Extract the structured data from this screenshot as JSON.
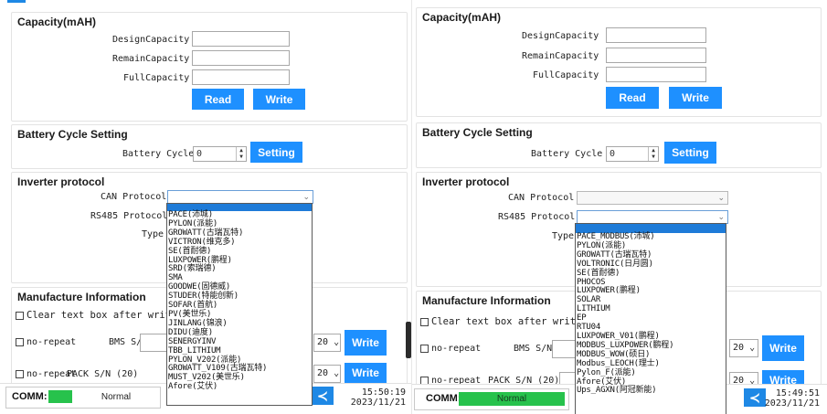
{
  "left": {
    "capacity": {
      "title": "Capacity(mAH)",
      "design_label": "DesignCapacity",
      "remain_label": "RemainCapacity",
      "full_label": "FullCapacity",
      "read_label": "Read",
      "write_label": "Write"
    },
    "cycle": {
      "title": "Battery Cycle Setting",
      "label": "Battery Cycle",
      "value": "0",
      "setting_label": "Setting"
    },
    "inverter": {
      "title": "Inverter protocol",
      "can_label": "CAN Protocol",
      "rs485_label": "RS485 Protocol",
      "type_label": "Type",
      "options": [
        "PACE(沛城)",
        "PYLON(派能)",
        "GROWATT(古瑞瓦特)",
        "VICTRON(维克多)",
        "SE(首耐德)",
        "LUXPOWER(鹏程)",
        "SRD(索瑞德)",
        "SMA",
        "GOODWE(固德威)",
        "STUDER(特能创新)",
        "SOFAR(首航)",
        "PV(美世乐)",
        "JINLANG(锦浪)",
        "DIDU(迪度)",
        "SENERGYINV",
        "TBB_LITHIUM",
        "PYLON_V202(派能)",
        "GROWATT_V109(古瑞瓦特)",
        "MUST_V202(美世乐)",
        "Afore(艾伏)"
      ]
    },
    "manufacture": {
      "title": "Manufacture Information",
      "clear_label": "Clear text box after writing",
      "norepeat_label": "no-repeat",
      "bms_label": "BMS S/N",
      "pack_label": "PACK S/N (20)",
      "len_value": "20",
      "write_label": "Write"
    },
    "status": {
      "comm_label": "COMM:",
      "comm_state": "Normal",
      "time": "15:50:19",
      "date": "2023/11/21"
    }
  },
  "right": {
    "capacity": {
      "title": "Capacity(mAH)",
      "design_label": "DesignCapacity",
      "remain_label": "RemainCapacity",
      "full_label": "FullCapacity",
      "read_label": "Read",
      "write_label": "Write"
    },
    "cycle": {
      "title": "Battery Cycle Setting",
      "label": "Battery Cycle",
      "value": "0",
      "setting_label": "Setting"
    },
    "inverter": {
      "title": "Inverter protocol",
      "can_label": "CAN Protocol",
      "rs485_label": "RS485 Protocol",
      "type_label": "Type",
      "options": [
        "PACE_MODBUS(沛城)",
        "PYLON(派能)",
        "GROWATT(古瑞瓦特)",
        "VOLTRONIC(日月圆)",
        "SE(首耐德)",
        "PHOCOS",
        "LUXPOWER(鹏程)",
        "SOLAR",
        "LITHIUM",
        "EP",
        "RTU04",
        "LUXPOWER_V01(鹏程)",
        "MODBUS_LUXPOWER(鹏程)",
        "MODBUS_WOW(硕日)",
        "Modbus_LEOCH(理士)",
        "Pylon_F(派能)",
        "Afore(艾伏)",
        "Ups_AGXN(阿冠新能)"
      ]
    },
    "manufacture": {
      "title": "Manufacture Information",
      "clear_label": "Clear text box after writing",
      "norepeat_label": "no-repeat",
      "bms_label": "BMS S/N",
      "pack_label": "PACK S/N (20)",
      "len_value": "20",
      "write_label": "Write"
    },
    "status": {
      "comm_label": "COMM:",
      "comm_state": "Normal",
      "time": "15:49:51",
      "date": "2023/11/21"
    }
  },
  "colors": {
    "accent": "#1e90ff",
    "comm_ok": "#27c24c",
    "dropdown_highlight": "#1e7bd8"
  }
}
